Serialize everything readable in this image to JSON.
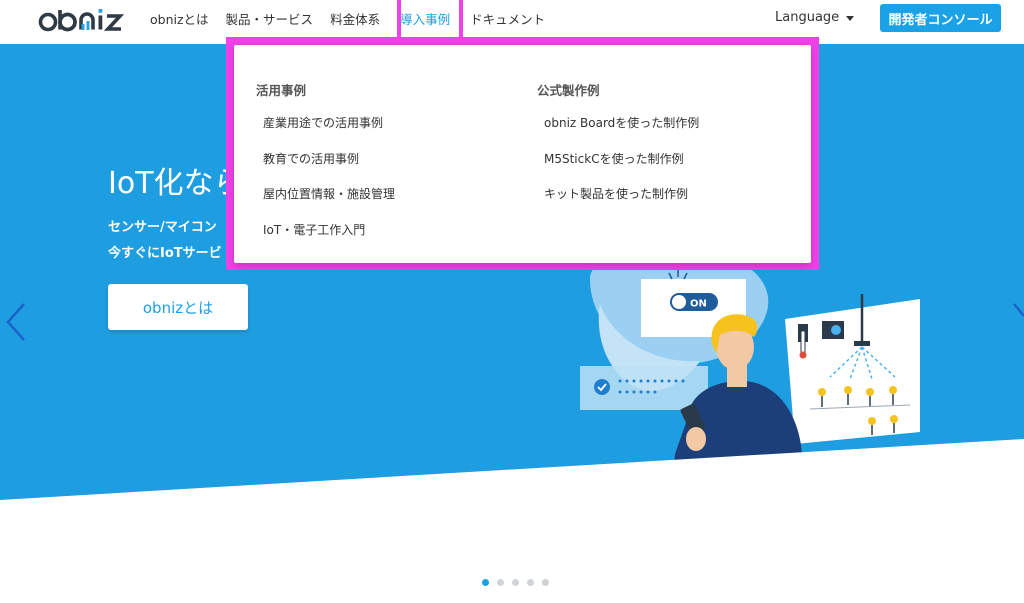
{
  "header": {
    "logo": "obniz",
    "nav": [
      {
        "label": "obnizとは"
      },
      {
        "label": "製品・サービス"
      },
      {
        "label": "料金体系"
      },
      {
        "label": "導入事例"
      },
      {
        "label": "ドキュメント"
      }
    ],
    "language_label": "Language",
    "console_button": "開発者コンソール"
  },
  "hero": {
    "title": "IoT化なら",
    "subtitle_line1": "センサー/マイコン",
    "subtitle_line2": "今すぐにIoTサービ",
    "button": "obnizとは",
    "illustration_toggle": "ON"
  },
  "dropdown": {
    "left": {
      "heading": "活用事例",
      "items": [
        "産業用途での活用事例",
        "教育での活用事例",
        "屋内位置情報・施設管理",
        "IoT・電子工作入門"
      ]
    },
    "right": {
      "heading": "公式製作例",
      "items": [
        "obniz Boardを使った制作例",
        "M5StickCを使った制作例",
        "キット製品を使った制作例"
      ]
    }
  },
  "carousel": {
    "slide_count": 5,
    "active_index": 0
  },
  "colors": {
    "brand_blue": "#1aa1e6",
    "hero_blue": "#1e9ee0",
    "highlight": "#f041e8"
  },
  "icons": [
    "chevron-left-icon",
    "chevron-right-icon",
    "caret-down-icon"
  ]
}
